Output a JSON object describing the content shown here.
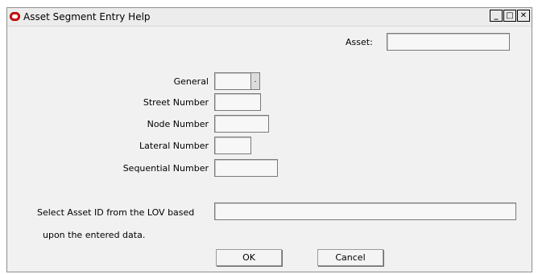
{
  "window": {
    "title": "Asset Segment Entry Help",
    "minimize": "_",
    "maximize": "□",
    "close": "✕"
  },
  "form": {
    "asset_label": "Asset:",
    "asset_value": "",
    "general_label": "General",
    "general_value": "",
    "lov_button": ".",
    "street_label": "Street Number",
    "street_value": "",
    "node_label": "Node Number",
    "node_value": "",
    "lateral_label": "Lateral Number",
    "lateral_value": "",
    "sequential_label": "Sequential Number",
    "sequential_value": "",
    "select_label_line1": "Select Asset ID from the LOV based",
    "select_label_line2": "upon the entered data.",
    "select_value": ""
  },
  "buttons": {
    "ok": "OK",
    "cancel": "Cancel"
  },
  "icons": {
    "app": "oracle-logo-icon"
  },
  "colors": {
    "window_bg": "#f1f1f1",
    "app_icon": "#d11b1b"
  }
}
